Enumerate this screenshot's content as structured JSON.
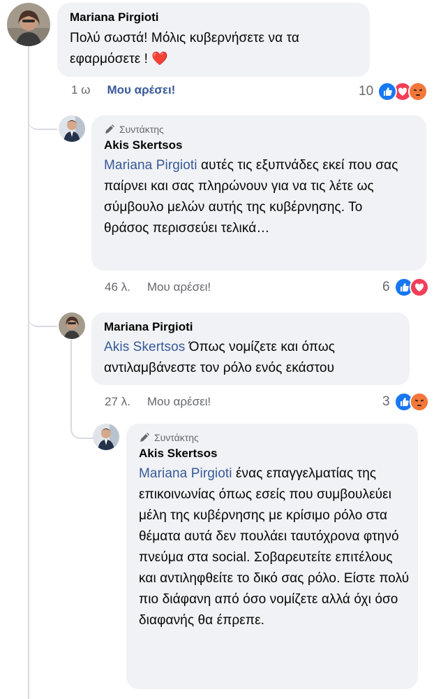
{
  "comments": [
    {
      "author": "Mariana Pirgioti",
      "text": "Πολύ σωστά! Μόλις κυβερνήσετε να τα εφαρμόσετε !",
      "emoji": "❤️",
      "time": "1 ω",
      "like_label": "Μου αρέσει!",
      "reaction_count": "10",
      "reactions": [
        "like-icon",
        "love-icon",
        "angry-icon"
      ]
    },
    {
      "role": "Συντάκτης",
      "author": "Akis Skertsos",
      "mention": "Mariana Pirgioti",
      "text": " αυτές τις εξυπνάδες εκεί που σας παίρνει και σας πληρώνουν για να τις λέτε ως σύμβουλο μελών αυτής της κυβέρνησης. Το θράσος περισσεύει τελικά…",
      "time": "46 λ.",
      "like_label": "Μου αρέσει!",
      "reaction_count": "6",
      "reactions": [
        "like-icon",
        "love-icon"
      ]
    },
    {
      "author": "Mariana Pirgioti",
      "mention": "Akis Skertsos",
      "text": " Όπως νομίζετε και όπως αντιλαμβάνεστε τον ρόλο ενός εκάστου",
      "time": "27 λ.",
      "like_label": "Μου αρέσει!",
      "reaction_count": "3",
      "reactions": [
        "like-icon",
        "angry-icon"
      ]
    },
    {
      "role": "Συντάκτης",
      "author": "Akis Skertsos",
      "mention": "Mariana Pirgioti",
      "text": " ένας επαγγελματίας της επικοινωνίας όπως εσείς που συμβουλεύει μέλη της κυβέρνησης με κρίσιμο ρόλο στα θέματα αυτά δεν πουλάει ταυτόχρονα φτηνό πνεύμα στα social. Σοβαρευτείτε επιτέλους και αντιληφθείτε το δικό σας ρόλο. Είστε πολύ πιο διάφανη από όσο νομίζετε αλλά όχι όσο διαφανής θα έπρεπε."
    }
  ],
  "colors": {
    "like": "#1877f2",
    "love": "#f33e58",
    "angry": "#f7b125",
    "mention": "#385898"
  }
}
